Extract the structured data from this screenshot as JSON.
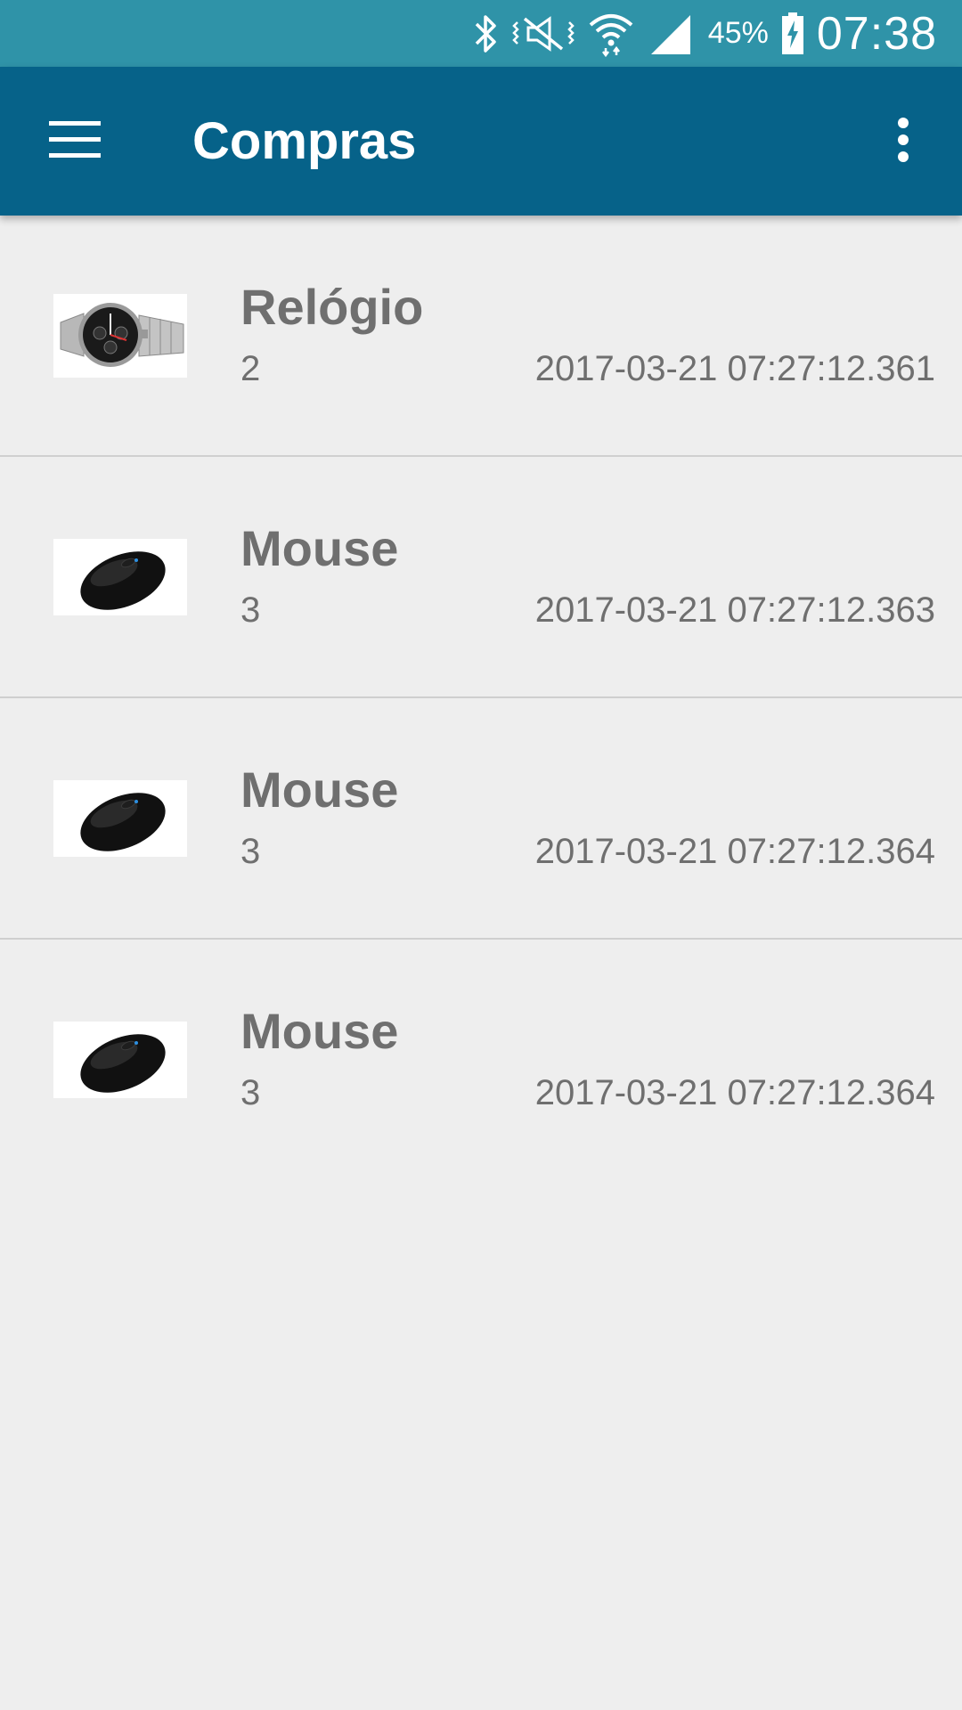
{
  "status_bar": {
    "battery_percent": "45%",
    "time": "07:38",
    "icons": [
      "bluetooth-icon",
      "vibrate-icon",
      "wifi-icon",
      "signal-icon",
      "battery-charging-icon"
    ],
    "background": "#2f93a8"
  },
  "app_bar": {
    "title": "Compras",
    "menu_icon": "hamburger-menu-icon",
    "overflow_icon": "more-vert-icon",
    "background": "#066289"
  },
  "purchases": [
    {
      "name": "Relógio",
      "quantity": "2",
      "date": "2017-03-21 07:27:12.361",
      "image": "watch"
    },
    {
      "name": "Mouse",
      "quantity": "3",
      "date": "2017-03-21 07:27:12.363",
      "image": "mouse"
    },
    {
      "name": "Mouse",
      "quantity": "3",
      "date": "2017-03-21 07:27:12.364",
      "image": "mouse"
    },
    {
      "name": "Mouse",
      "quantity": "3",
      "date": "2017-03-21 07:27:12.364",
      "image": "mouse"
    }
  ]
}
